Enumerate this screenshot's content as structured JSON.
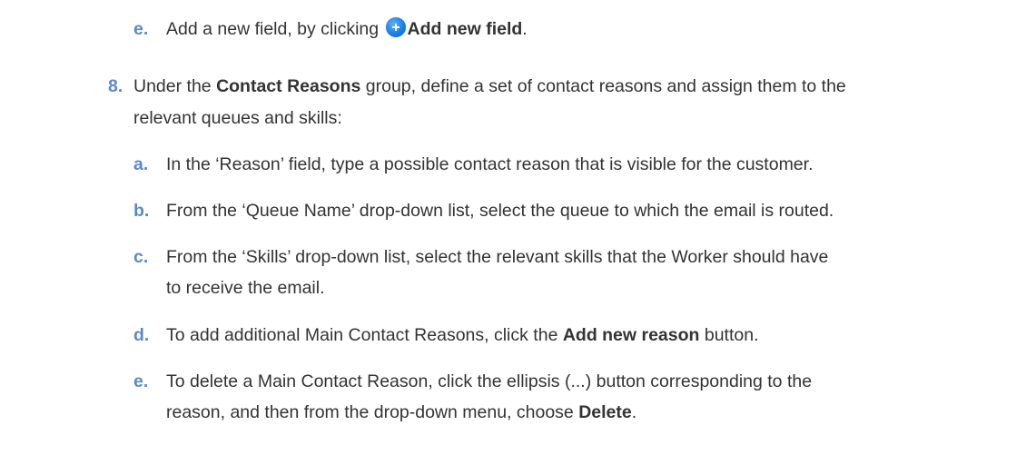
{
  "step_7e": {
    "marker": "e.",
    "text_before": "Add a new field, by clicking ",
    "bold": "Add new field",
    "text_after": ".",
    "icon": "add-circle-icon"
  },
  "step_8": {
    "marker": "8.",
    "line1_before": "Under the ",
    "line1_bold": "Contact Reasons",
    "line1_after": " group, define a set of contact reasons and assign them to the",
    "line2": "relevant queues and skills:"
  },
  "substeps": {
    "a": {
      "marker": "a.",
      "text": "In the ‘Reason’ field, type a possible contact reason that is visible for the customer."
    },
    "b": {
      "marker": "b.",
      "text": "From the ‘Queue Name’ drop-down list, select the queue to which the email is routed."
    },
    "c": {
      "marker": "c.",
      "line1": "From the ‘Skills’ drop-down list, select the relevant skills that the Worker should have",
      "line2": "to receive the email."
    },
    "d": {
      "marker": "d.",
      "text_before": "To add additional Main Contact Reasons, click the ",
      "bold": "Add new reason",
      "text_after": " button."
    },
    "e": {
      "marker": "e.",
      "line1": "To delete a Main Contact Reason, click the ellipsis (...) button corresponding to the",
      "line2_before": "reason, and then from the drop-down menu, choose ",
      "line2_bold": "Delete",
      "line2_after": "."
    }
  },
  "colors": {
    "marker": "#5a8ac6",
    "text": "#333333",
    "icon": "#1c7de8"
  }
}
